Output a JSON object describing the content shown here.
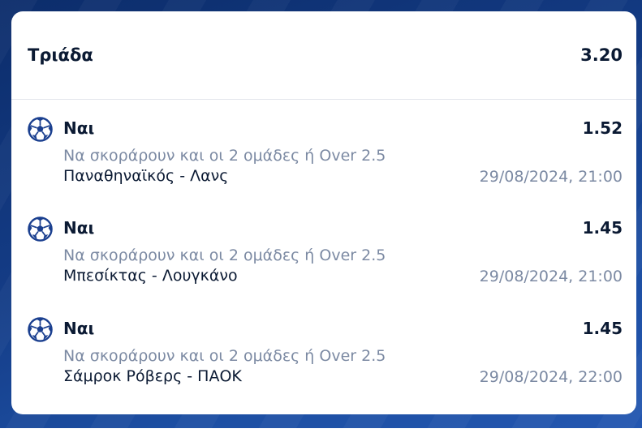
{
  "bet": {
    "type_label": "Τριάδα",
    "total_odds": "3.20"
  },
  "selections": [
    {
      "icon": "soccer-ball-icon",
      "pick": "Ναι",
      "odds": "1.52",
      "market": "Να σκοράρουν και οι 2 ομάδες ή Over 2.5",
      "event": "Παναθηναϊκός - Λανς",
      "datetime": "29/08/2024, 21:00"
    },
    {
      "icon": "soccer-ball-icon",
      "pick": "Ναι",
      "odds": "1.45",
      "market": "Να σκοράρουν και οι 2 ομάδες ή Over 2.5",
      "event": "Μπεσίκτας - Λουγκάνο",
      "datetime": "29/08/2024, 21:00"
    },
    {
      "icon": "soccer-ball-icon",
      "pick": "Ναι",
      "odds": "1.45",
      "market": "Να σκοράρουν και οι 2 ομάδες ή Over 2.5",
      "event": "Σάμροκ Ρόβερς - ΠΑΟΚ",
      "datetime": "29/08/2024, 22:00"
    }
  ],
  "colors": {
    "background": "#143c86",
    "text_primary": "#0b1a33",
    "text_secondary": "#7c8aa3",
    "icon": "#1a3f8f"
  }
}
